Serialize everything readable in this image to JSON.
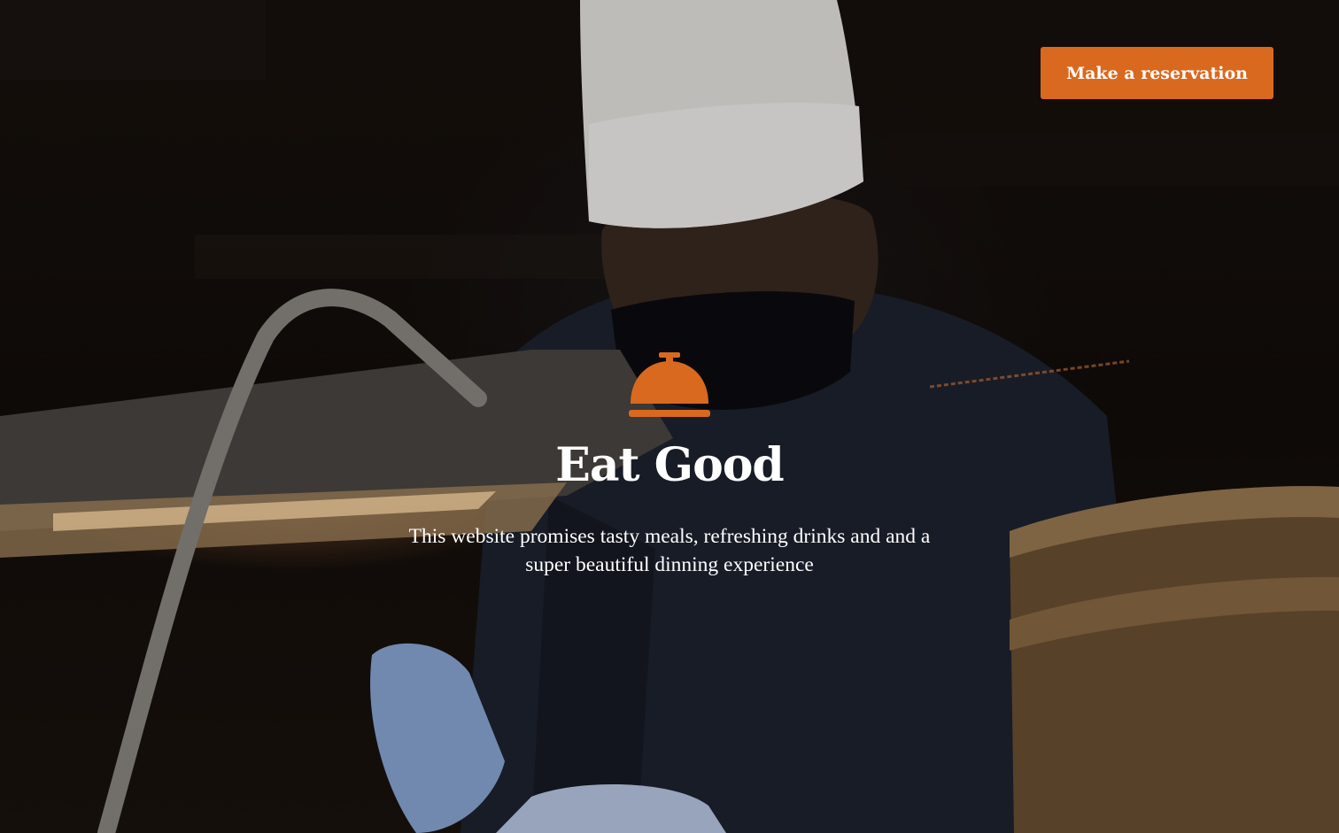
{
  "header": {
    "reservation_button_label": "Make a reservation"
  },
  "hero": {
    "icon": "service-bell-cloche-icon",
    "title": "Eat Good",
    "subtitle": "This website promises tasty meals, refreshing drinks and and a super beautiful dinning experience"
  },
  "colors": {
    "accent": "#d9691f",
    "text": "#ffffff",
    "background": "#120d0a"
  }
}
